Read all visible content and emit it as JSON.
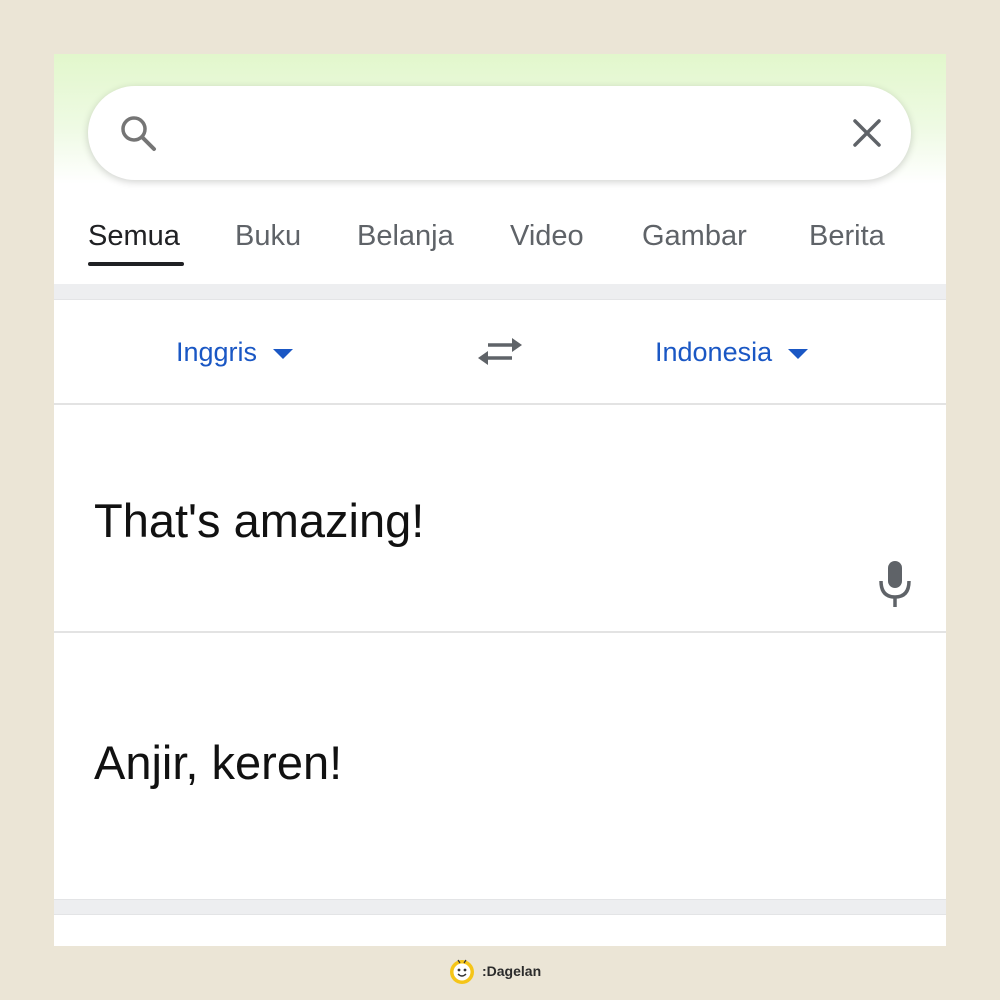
{
  "search": {
    "value": "",
    "placeholder": "",
    "search_icon": "search-icon",
    "clear_icon": "close-icon"
  },
  "tabs": [
    {
      "label": "Semua",
      "active": true
    },
    {
      "label": "Buku",
      "active": false
    },
    {
      "label": "Belanja",
      "active": false
    },
    {
      "label": "Video",
      "active": false
    },
    {
      "label": "Gambar",
      "active": false
    },
    {
      "label": "Berita",
      "active": false
    }
  ],
  "translate": {
    "source_lang": "Inggris",
    "target_lang": "Indonesia",
    "swap_icon": "swap-arrows-icon",
    "source_text": "That's amazing!",
    "target_text": "Anjir, keren!",
    "mic_icon": "microphone-icon"
  },
  "watermark": {
    "text": ":Dagelan"
  },
  "colors": {
    "accent": "#1a57c4",
    "background": "#ebe5d6",
    "header_tint": "#e2f7cc"
  }
}
